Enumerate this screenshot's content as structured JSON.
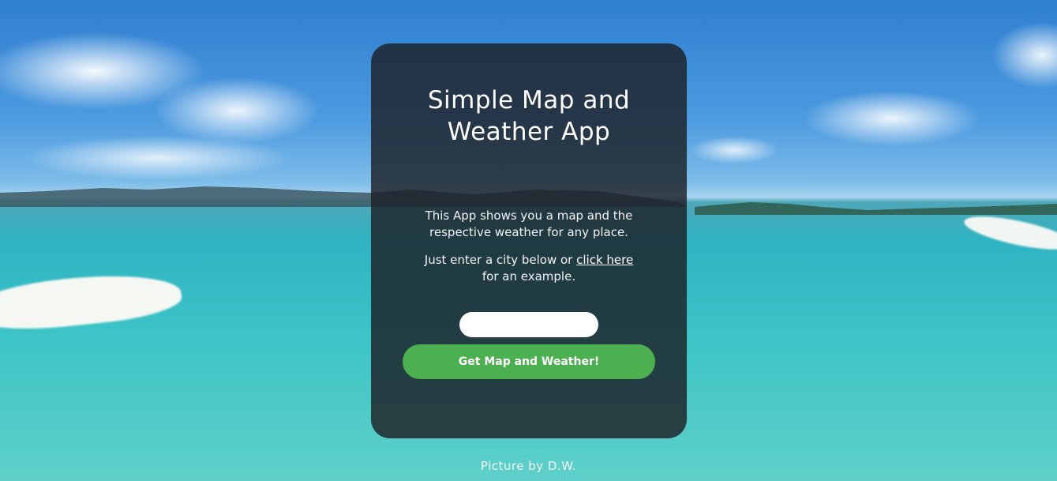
{
  "app": {
    "title": "Simple Map and Weather App",
    "description": "This App shows you a map and the respective weather for any place.",
    "instruction_before": "Just enter a city below or",
    "example_link": "click here",
    "instruction_after": "for an example.",
    "city_input_value": "",
    "submit_label": "Get Map and Weather!"
  },
  "footer": {
    "credit": "Picture by D.W."
  },
  "colors": {
    "card_background": "#1c2026",
    "button_green": "#4caf50",
    "text": "#ffffff"
  }
}
